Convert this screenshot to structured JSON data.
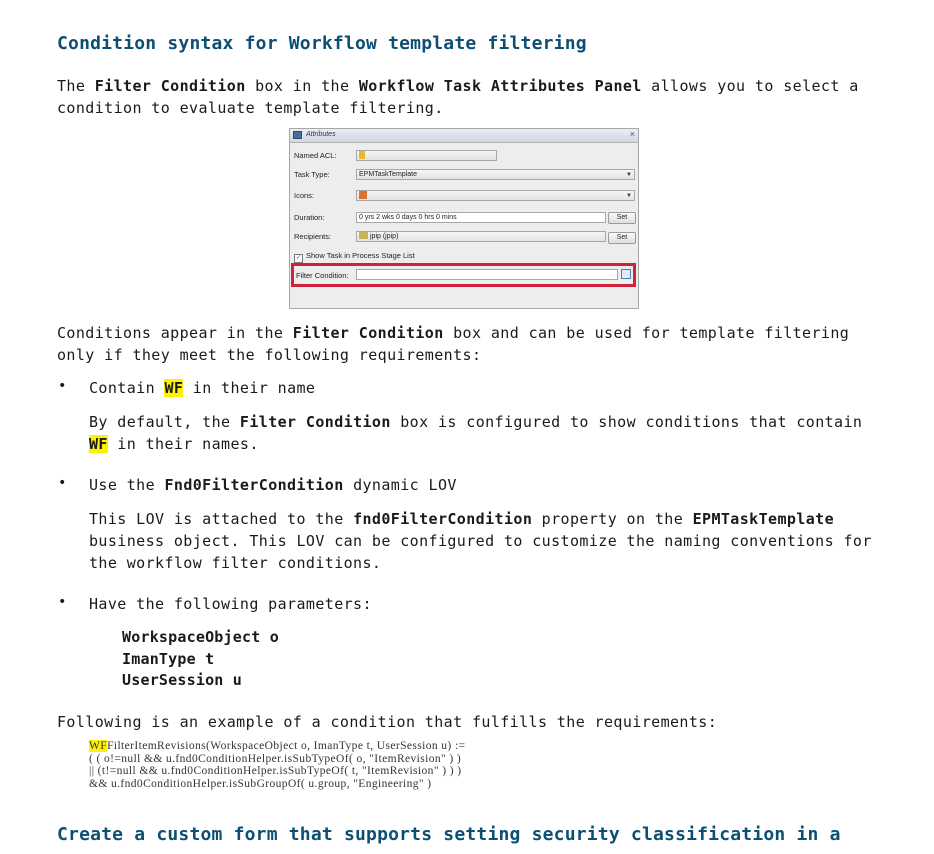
{
  "heading1": "Condition syntax for Workflow template filtering",
  "intro": {
    "p1": "The ",
    "b1": "Filter Condition",
    "p2": " box in the ",
    "b2": "Workflow Task Attributes Panel",
    "p3": " allows you to select a condition to evaluate template filtering."
  },
  "panel": {
    "title": "Attributes",
    "close_glyph": "×",
    "named_acl_label": "Named ACL:",
    "task_type_label": "Task Type:",
    "task_type_value": "EPMTaskTemplate",
    "icons_label": "Icons:",
    "duration_label": "Duration:",
    "duration_value": "0 yrs 2 wks 0 days 0 hrs 0 mins",
    "recipients_label": "Recipients:",
    "recipients_value": "jpip (jpip)",
    "set_label": "Set",
    "show_task_label": "Show Task in Process Stage List",
    "filter_condition_label": "Filter Condition:",
    "filter_condition_value": "",
    "dropdown_glyph": "▼",
    "check_glyph": "✓"
  },
  "conditions_para": {
    "p1": "Conditions appear in the ",
    "b1": "Filter Condition",
    "p2": " box and can be used for template filtering only if they meet the following requirements:"
  },
  "bullet_glyph": "•",
  "bullet1": {
    "p1": "Contain ",
    "hl": "WF",
    "p2": " in their name",
    "detail_p1": "By default, the ",
    "detail_b1": "Filter Condition",
    "detail_p2": " box is configured to show conditions that contain ",
    "detail_hl": "WF",
    "detail_p3": " in their names."
  },
  "bullet2": {
    "p1": "Use the ",
    "b1": "Fnd0FilterCondition",
    "p2": " dynamic LOV",
    "detail_p1": "This LOV is attached to the ",
    "detail_b1": "fnd0FilterCondition",
    "detail_p2": " property on the ",
    "detail_b2": "EPMTaskTemplate",
    "detail_p3": " business object. This LOV can be configured to customize the naming conventions for the workflow filter conditions."
  },
  "bullet3": {
    "text": "Have the following parameters:",
    "params": [
      "WorkspaceObject o",
      "ImanType t",
      "UserSession u"
    ]
  },
  "example_intro": "Following is an example of a condition that fulfills the requirements:",
  "code": {
    "hl": "WF",
    "line1_rest": "FilterItemRevisions(WorkspaceObject o, ImanType t, UserSession u) :=",
    "line2": "( ( o!=null && u.fnd0ConditionHelper.isSubTypeOf( o, \"ItemRevision\" ) )",
    "line3": "|| (t!=null && u.fnd0ConditionHelper.isSubTypeOf( t, \"ItemRevision\" ) ) )",
    "line4": "&& u.fnd0ConditionHelper.isSubGroupOf( u.group, \"Engineering\" )"
  },
  "heading2": "Create a custom form that supports setting security classification in a"
}
